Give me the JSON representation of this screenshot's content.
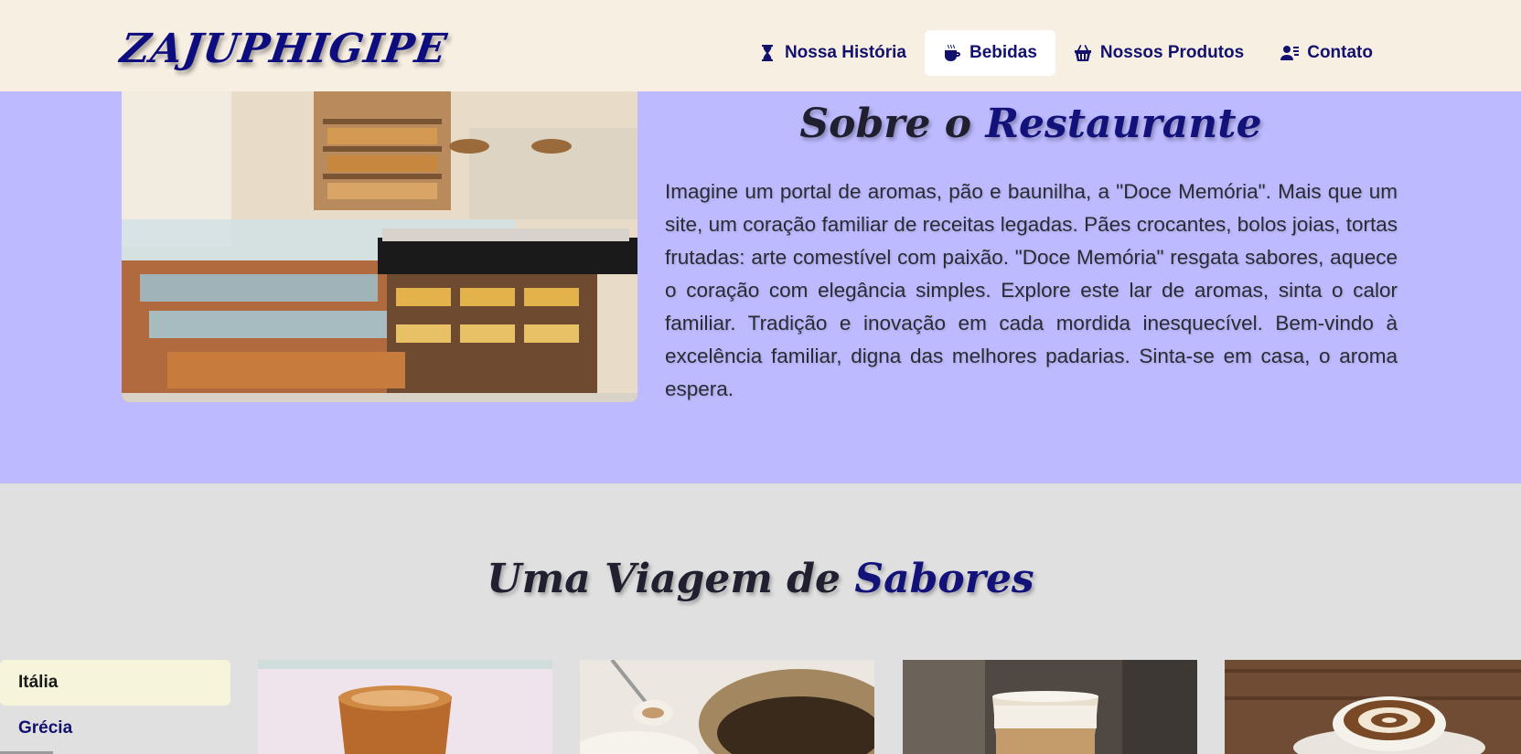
{
  "header": {
    "logo": "ZAJUPHIGIPE",
    "nav": [
      {
        "label": "Nossa História",
        "icon": "hourglass-icon"
      },
      {
        "label": "Bebidas",
        "icon": "coffee-cup-icon",
        "active": true
      },
      {
        "label": "Nossos Produtos",
        "icon": "basket-icon"
      },
      {
        "label": "Contato",
        "icon": "contact-card-icon"
      }
    ]
  },
  "about": {
    "title_prefix": "Sobre o",
    "title_accent": "Restaurante",
    "text": "Imagine um portal de aromas, pão e baunilha, a \"Doce Memória\". Mais que um site, um coração familiar de receitas legadas. Pães crocantes, bolos joias, tortas frutadas: arte comestível com paixão. \"Doce Memória\" resgata sabores, aquece o coração com elegância simples. Explore este lar de aromas, sinta o calor familiar. Tradição e inovação em cada mordida inesquecível. Bem-vindo à excelência familiar, digna das melhores padarias. Sinta-se em casa, o aroma espera."
  },
  "sabores": {
    "title_prefix": "Uma Viagem de",
    "title_accent": "Sabores",
    "menu": [
      {
        "label": "Itália",
        "active": true
      },
      {
        "label": "Grécia",
        "active": false
      }
    ]
  },
  "colors": {
    "header_bg": "#f8efe3",
    "about_bg": "#bdbaff",
    "page_bg": "#e0e0e0",
    "brand_navy": "#12127a"
  }
}
